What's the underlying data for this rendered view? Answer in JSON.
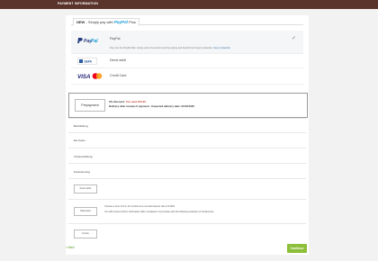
{
  "header": {
    "title": "PAYMENT INFORMATION"
  },
  "tabs": {
    "new_label": "NEW",
    "text": "- Simply pay with",
    "paypal_word": "PayPal",
    "suffix": "Plus"
  },
  "payment_methods": [
    {
      "name": "PayPal",
      "description": "Pay over the PayPal Site: simply enter the account and by paying and benefit from buyer protection.",
      "link": "buyer protection"
    },
    {
      "name": "Direct debit"
    },
    {
      "name": "Credit Card"
    }
  ],
  "prepayment": {
    "button_label": "Prepayment",
    "discount_prefix": "2% discount:",
    "discount_value": "You save €15.35",
    "delivery_text": "Delivery after receipt of payment - Expected delivery date: 20.08.2020"
  },
  "options": {
    "rows": [
      "Barzahlung",
      "EC-Karte",
      "Vorauszahlung",
      "Finanzierung"
    ],
    "rechnung": "Rechnung",
    "direct_debit_btn": "Direct debit",
    "klarna_btn": "Ratenkauf",
    "klarna_line1": "Choose a term of 6 or 12 months at a nominal interest rate of 9.90%",
    "klarna_line2": "You will receive further information after completion of purchase with the following selection of instalments.",
    "invoice_btn": "Invoice"
  },
  "footer": {
    "cancel": "« Back",
    "continue": "Continue"
  }
}
